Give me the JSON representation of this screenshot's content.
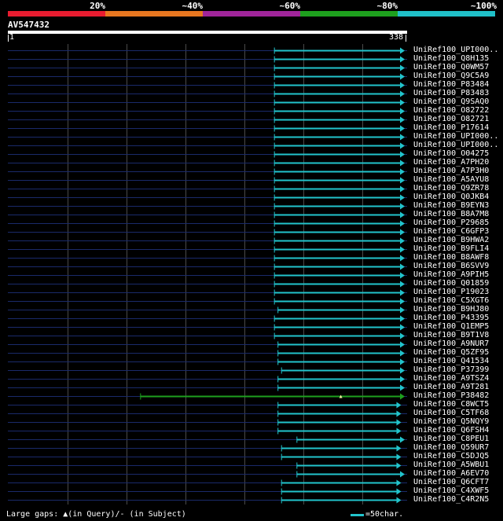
{
  "identity_scale": {
    "labels": [
      "20%",
      "~40%",
      "~60%",
      "~80%",
      "~100%"
    ],
    "colors": [
      "#e81c30",
      "#e87720",
      "#a0259a",
      "#1ea01e",
      "#20c0c8"
    ]
  },
  "query": {
    "name": "AV547432",
    "start_label": "1",
    "end_label": "338",
    "length": 338
  },
  "colors": {
    "background": "#000000",
    "query_line": "#1a2a6a",
    "hit_line": "#22c4cc",
    "low_identity_hit": "#1ea01e",
    "gap_marker": "#f0f0a0"
  },
  "hits": [
    {
      "label": "UniRef100_UPI000..",
      "start": 226,
      "end": 336,
      "color": "cyan"
    },
    {
      "label": "UniRef100_Q8H135",
      "start": 226,
      "end": 336,
      "color": "cyan"
    },
    {
      "label": "UniRef100_Q0WM57",
      "start": 226,
      "end": 336,
      "color": "cyan"
    },
    {
      "label": "UniRef100_Q9C5A9",
      "start": 226,
      "end": 336,
      "color": "cyan"
    },
    {
      "label": "UniRef100_P83484",
      "start": 226,
      "end": 336,
      "color": "cyan"
    },
    {
      "label": "UniRef100_P83483",
      "start": 226,
      "end": 336,
      "color": "cyan"
    },
    {
      "label": "UniRef100_Q9SAQ0",
      "start": 226,
      "end": 336,
      "color": "cyan"
    },
    {
      "label": "UniRef100_O82722",
      "start": 226,
      "end": 336,
      "color": "cyan"
    },
    {
      "label": "UniRef100_O82721",
      "start": 226,
      "end": 336,
      "color": "cyan"
    },
    {
      "label": "UniRef100_P17614",
      "start": 226,
      "end": 336,
      "color": "cyan"
    },
    {
      "label": "UniRef100_UPI000..",
      "start": 226,
      "end": 336,
      "color": "cyan"
    },
    {
      "label": "UniRef100_UPI000..",
      "start": 226,
      "end": 336,
      "color": "cyan"
    },
    {
      "label": "UniRef100_O04275",
      "start": 226,
      "end": 336,
      "color": "cyan"
    },
    {
      "label": "UniRef100_A7PH20",
      "start": 226,
      "end": 336,
      "color": "cyan"
    },
    {
      "label": "UniRef100_A7P3H0",
      "start": 226,
      "end": 336,
      "color": "cyan"
    },
    {
      "label": "UniRef100_A5AYU8",
      "start": 226,
      "end": 336,
      "color": "cyan"
    },
    {
      "label": "UniRef100_Q9ZR78",
      "start": 226,
      "end": 336,
      "color": "cyan"
    },
    {
      "label": "UniRef100_Q0JKB4",
      "start": 226,
      "end": 336,
      "color": "cyan"
    },
    {
      "label": "UniRef100_B9EYN3",
      "start": 226,
      "end": 336,
      "color": "cyan"
    },
    {
      "label": "UniRef100_B8A7M8",
      "start": 226,
      "end": 336,
      "color": "cyan"
    },
    {
      "label": "UniRef100_P29685",
      "start": 226,
      "end": 336,
      "color": "cyan"
    },
    {
      "label": "UniRef100_C6GFP3",
      "start": 226,
      "end": 336,
      "color": "cyan"
    },
    {
      "label": "UniRef100_B9HWA2",
      "start": 226,
      "end": 336,
      "color": "cyan"
    },
    {
      "label": "UniRef100_B9FLI4",
      "start": 226,
      "end": 336,
      "color": "cyan"
    },
    {
      "label": "UniRef100_B8AWF8",
      "start": 226,
      "end": 336,
      "color": "cyan"
    },
    {
      "label": "UniRef100_B6SVV9",
      "start": 226,
      "end": 336,
      "color": "cyan"
    },
    {
      "label": "UniRef100_A9PIH5",
      "start": 226,
      "end": 336,
      "color": "cyan"
    },
    {
      "label": "UniRef100_Q01859",
      "start": 226,
      "end": 336,
      "color": "cyan"
    },
    {
      "label": "UniRef100_P19023",
      "start": 226,
      "end": 336,
      "color": "cyan"
    },
    {
      "label": "UniRef100_C5XGT6",
      "start": 226,
      "end": 336,
      "color": "cyan"
    },
    {
      "label": "UniRef100_B9HJ80",
      "start": 229,
      "end": 336,
      "color": "cyan"
    },
    {
      "label": "UniRef100_P43395",
      "start": 226,
      "end": 336,
      "color": "cyan"
    },
    {
      "label": "UniRef100_Q1EMP5",
      "start": 226,
      "end": 336,
      "color": "cyan"
    },
    {
      "label": "UniRef100_B9T1V8",
      "start": 226,
      "end": 336,
      "color": "cyan"
    },
    {
      "label": "UniRef100_A9NUR7",
      "start": 229,
      "end": 336,
      "color": "cyan"
    },
    {
      "label": "UniRef100_Q5ZF95",
      "start": 229,
      "end": 336,
      "color": "cyan"
    },
    {
      "label": "UniRef100_Q41534",
      "start": 229,
      "end": 336,
      "color": "cyan"
    },
    {
      "label": "UniRef100_P37399",
      "start": 232,
      "end": 336,
      "color": "cyan"
    },
    {
      "label": "UniRef100_A9TSZ4",
      "start": 229,
      "end": 336,
      "color": "cyan"
    },
    {
      "label": "UniRef100_A9T281",
      "start": 229,
      "end": 336,
      "color": "cyan"
    },
    {
      "label": "UniRef100_P38482",
      "start": 113,
      "end": 336,
      "color": "green",
      "gap_at": 282
    },
    {
      "label": "UniRef100_C8WCT5",
      "start": 229,
      "end": 333,
      "color": "cyan"
    },
    {
      "label": "UniRef100_C5TF68",
      "start": 229,
      "end": 333,
      "color": "cyan"
    },
    {
      "label": "UniRef100_Q5NQY9",
      "start": 229,
      "end": 333,
      "color": "cyan"
    },
    {
      "label": "UniRef100_Q6FSH4",
      "start": 229,
      "end": 333,
      "color": "cyan"
    },
    {
      "label": "UniRef100_C8PEU1",
      "start": 245,
      "end": 336,
      "color": "cyan"
    },
    {
      "label": "UniRef100_Q59UR7",
      "start": 232,
      "end": 333,
      "color": "cyan"
    },
    {
      "label": "UniRef100_C5DJQ5",
      "start": 232,
      "end": 333,
      "color": "cyan"
    },
    {
      "label": "UniRef100_A5WBU1",
      "start": 245,
      "end": 333,
      "color": "cyan"
    },
    {
      "label": "UniRef100_A6EV70",
      "start": 245,
      "end": 336,
      "color": "cyan"
    },
    {
      "label": "UniRef100_Q6CFT7",
      "start": 232,
      "end": 333,
      "color": "cyan"
    },
    {
      "label": "UniRef100_C4XWF5",
      "start": 232,
      "end": 333,
      "color": "cyan"
    },
    {
      "label": "UniRef100_C4R2N5",
      "start": 232,
      "end": 333,
      "color": "cyan"
    }
  ],
  "footer": {
    "gaps_text": "Large gaps: ▲(in Query)/- (in Subject)",
    "scale_label": "=50char."
  }
}
